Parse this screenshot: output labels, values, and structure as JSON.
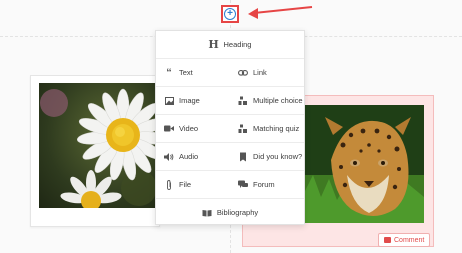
{
  "menu": {
    "heading": "Heading",
    "rows": [
      {
        "left": "Text",
        "right": "Link"
      },
      {
        "left": "Image",
        "right": "Multiple choice"
      },
      {
        "left": "Video",
        "right": "Matching quiz"
      },
      {
        "left": "Audio",
        "right": "Did you know?"
      },
      {
        "left": "File",
        "right": "Forum"
      }
    ],
    "bibliography": "Bibliography"
  },
  "right_card": {
    "comment_label": "Comment"
  },
  "colors": {
    "accent": "#2f7fd1",
    "highlight": "#e64545",
    "flag_bg": "#fde5e5"
  },
  "icons": {
    "add": "plus-circle-icon",
    "heading": "heading-icon",
    "text": "quote-icon",
    "link": "link-icon",
    "image": "image-icon",
    "multiple_choice": "multiple-choice-icon",
    "video": "video-icon",
    "matching_quiz": "matching-quiz-icon",
    "audio": "audio-icon",
    "did_you_know": "did-you-know-icon",
    "file": "paperclip-icon",
    "forum": "forum-icon",
    "bibliography": "book-icon",
    "comment": "comment-icon"
  }
}
